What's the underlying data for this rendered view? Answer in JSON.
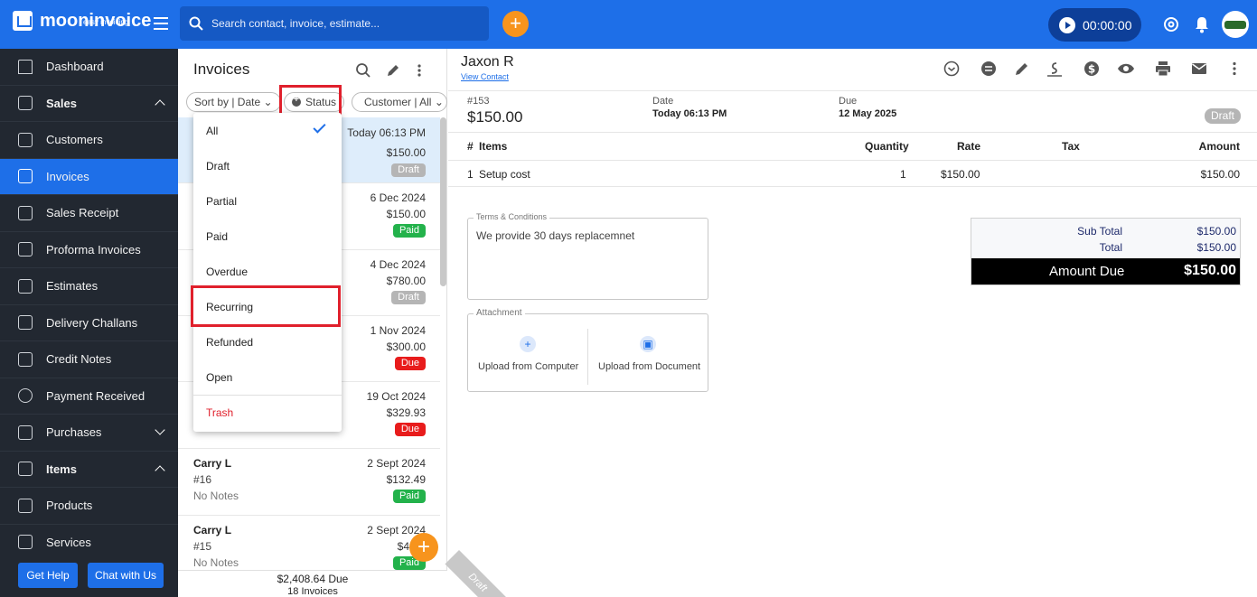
{
  "header": {
    "logo_text": "mooninvoice",
    "logo_sub": "easy invoicing",
    "search_placeholder": "Search contact, invoice, estimate...",
    "timer": "00:00:00",
    "colors": {
      "primary": "#1e6fe8",
      "accent": "#f7941d",
      "sidebar": "#222831"
    }
  },
  "sidebar": {
    "items": [
      {
        "label": "Dashboard",
        "icon": "home-icon"
      },
      {
        "label": "Sales",
        "icon": "dollar-doc-icon",
        "expanded": true
      },
      {
        "label": "Customers",
        "icon": "contacts-icon"
      },
      {
        "label": "Invoices",
        "icon": "invoice-icon",
        "active": true
      },
      {
        "label": "Sales Receipt",
        "icon": "receipt-icon"
      },
      {
        "label": "Proforma Invoices",
        "icon": "proforma-icon"
      },
      {
        "label": "Estimates",
        "icon": "estimate-icon"
      },
      {
        "label": "Delivery Challans",
        "icon": "challan-icon"
      },
      {
        "label": "Credit Notes",
        "icon": "credit-note-icon"
      },
      {
        "label": "Payment Received",
        "icon": "payment-icon"
      },
      {
        "label": "Purchases",
        "icon": "purchase-icon",
        "expanded": false
      },
      {
        "label": "Items",
        "icon": "items-icon",
        "expanded": true
      },
      {
        "label": "Products",
        "icon": "product-icon"
      },
      {
        "label": "Services",
        "icon": "service-icon"
      }
    ],
    "help_label": "Get Help",
    "chat_label": "Chat with Us"
  },
  "list": {
    "title": "Invoices",
    "sort_chip": "Sort by | Date",
    "status_chip": "Status",
    "customer_chip": "Customer | All",
    "rows": [
      {
        "date": "Today 06:13 PM",
        "amount": "$150.00",
        "status": "Draft"
      },
      {
        "date": "6 Dec 2024",
        "amount": "$150.00",
        "status": "Paid"
      },
      {
        "date": "4 Dec 2024",
        "amount": "$780.00",
        "status": "Draft"
      },
      {
        "date": "1 Nov 2024",
        "amount": "$300.00",
        "status": "Due"
      },
      {
        "date": "19 Oct 2024",
        "amount": "$329.93",
        "status": "Due"
      },
      {
        "name": "Carry L",
        "number": "#16",
        "notes": "No Notes",
        "date": "2 Sept 2024",
        "amount": "$132.49",
        "status": "Paid"
      },
      {
        "name": "Carry L",
        "number": "#15",
        "notes": "No Notes",
        "date": "2 Sept 2024",
        "amount": "$4",
        "status": "Paid"
      }
    ],
    "footer_due": "$2,408.64 Due",
    "footer_count": "18 Invoices"
  },
  "status_dropdown": {
    "options": [
      "All",
      "Draft",
      "Partial",
      "Paid",
      "Overdue",
      "Recurring",
      "Refunded",
      "Open",
      "Trash"
    ],
    "selected": "All"
  },
  "detail": {
    "customer_name": "Jaxon R",
    "view_contact": "View Contact",
    "invoice_no": "#153",
    "invoice_amount": "$150.00",
    "date_label": "Date",
    "date_value": "Today 06:13 PM",
    "due_label": "Due",
    "due_value": "12 May 2025",
    "status": "Draft",
    "table_headers": {
      "num": "#",
      "items": "Items",
      "quantity": "Quantity",
      "rate": "Rate",
      "tax": "Tax",
      "amount": "Amount"
    },
    "line_items": [
      {
        "num": "1",
        "item": "Setup cost",
        "quantity": "1",
        "rate": "$150.00",
        "tax": "",
        "amount": "$150.00"
      }
    ],
    "terms_label": "Terms & Conditions",
    "terms_text": "We provide 30 days replacemnet",
    "attachment_label": "Attachment",
    "upload_computer": "Upload from Computer",
    "upload_document": "Upload from Document",
    "subtotal_label": "Sub Total",
    "subtotal_value": "$150.00",
    "total_label": "Total",
    "total_value": "$150.00",
    "amount_due_label": "Amount Due",
    "amount_due_value": "$150.00",
    "ribbon": "Draft"
  }
}
